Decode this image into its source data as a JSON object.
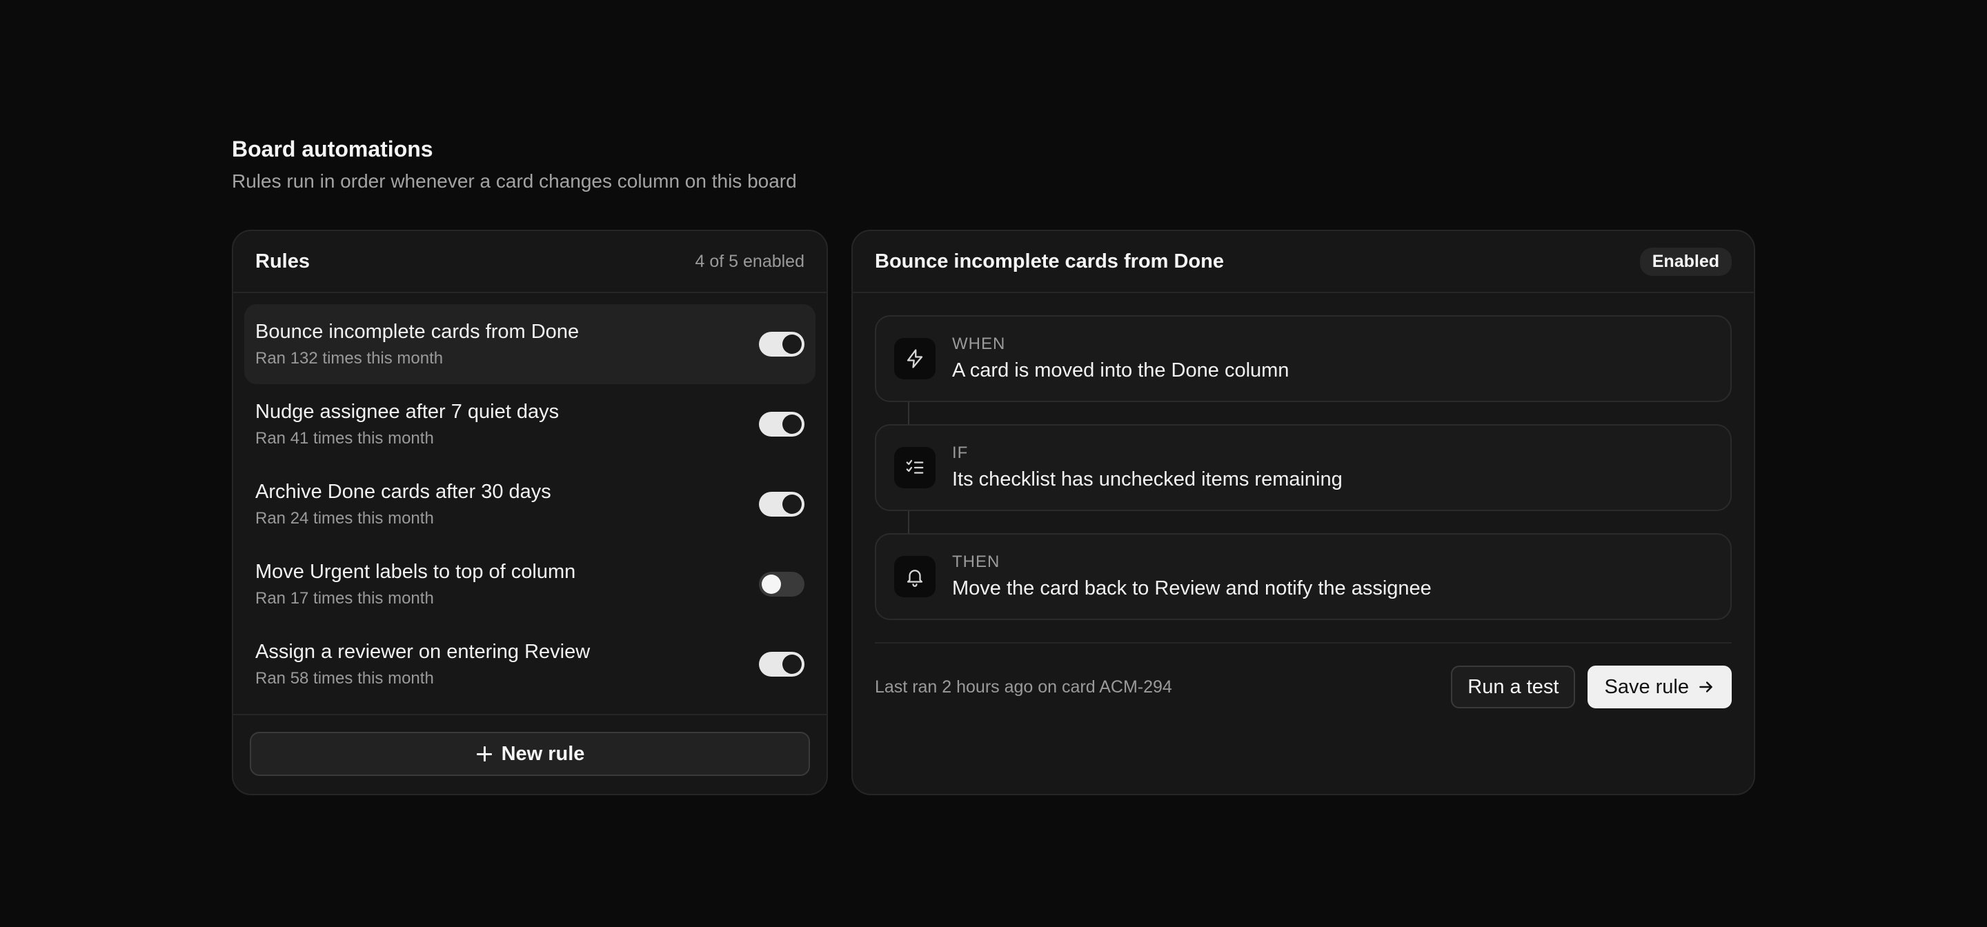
{
  "header": {
    "title": "Board automations",
    "subtitle": "Rules run in order whenever a card changes column on this board"
  },
  "rules_panel": {
    "title": "Rules",
    "count": "4 of 5 enabled",
    "items": [
      {
        "name": "Bounce incomplete cards from Done",
        "meta": "Ran 132 times this month",
        "enabled": true,
        "selected": true
      },
      {
        "name": "Nudge assignee after 7 quiet days",
        "meta": "Ran 41 times this month",
        "enabled": true,
        "selected": false
      },
      {
        "name": "Archive Done cards after 30 days",
        "meta": "Ran 24 times this month",
        "enabled": true,
        "selected": false
      },
      {
        "name": "Move Urgent labels to top of column",
        "meta": "Ran 17 times this month",
        "enabled": false,
        "selected": false
      },
      {
        "name": "Assign a reviewer on entering Review",
        "meta": "Ran 58 times this month",
        "enabled": true,
        "selected": false
      }
    ],
    "new_rule_label": "New rule"
  },
  "detail_panel": {
    "title": "Bounce incomplete cards from Done",
    "status": "Enabled",
    "steps": [
      {
        "kicker": "WHEN",
        "description": "A card is moved into the Done column",
        "icon": "lightning-bolt-icon"
      },
      {
        "kicker": "IF",
        "description": "Its checklist has unchecked items remaining",
        "icon": "checklist-icon"
      },
      {
        "kicker": "THEN",
        "description": "Move the card back to Review and notify the assignee",
        "icon": "bell-icon"
      }
    ],
    "last_ran": "Last ran 2 hours ago on card ACM-294",
    "run_test_label": "Run a test",
    "save_label": "Save rule"
  },
  "colors": {
    "background": "#0b0b0b",
    "panel": "#171717",
    "toggle_on": "#e8e8e8",
    "toggle_off": "#3a3a3a",
    "primary_button": "#f0f0f0"
  }
}
